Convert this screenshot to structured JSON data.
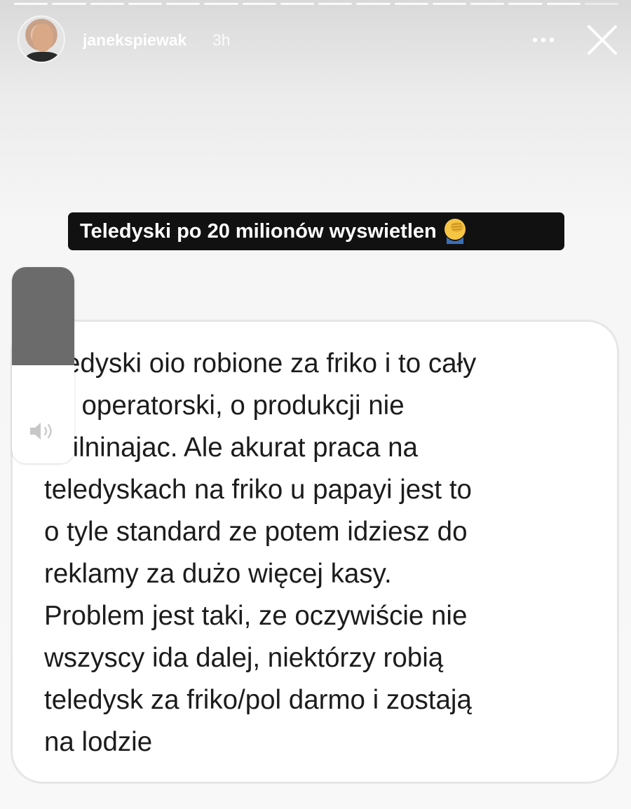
{
  "story": {
    "username": "janekspiewak",
    "time_ago": "3h",
    "segments": 16,
    "active_segment": 15
  },
  "caption": {
    "text": "Teledyski po 20 milionów wyswietlen",
    "emoji": "face-palm-emoji"
  },
  "message": {
    "text": "eledyski oio robione za friko i to cały\nan operatorski, o produkcji nie\nspilninajac. Ale akurat praca na\nteledyskach na friko u papayi jest to\no tyle standard ze potem idziesz do\nreklamy za dużo więcej kasy.\nProblem jest taki, ze oczywiście nie\nwszyscy ida dalej, niektórzy robią\nteledysk za friko/pol darmo i zostają\nna lodzie"
  },
  "volume": {
    "level": 0.5,
    "icon": "speaker-icon"
  },
  "icons": {
    "more": "more-dots-icon",
    "close": "close-icon"
  },
  "colors": {
    "caption_bg": "#111111",
    "card_bg": "#ffffff",
    "volume_fill": "#6b6b6b"
  }
}
